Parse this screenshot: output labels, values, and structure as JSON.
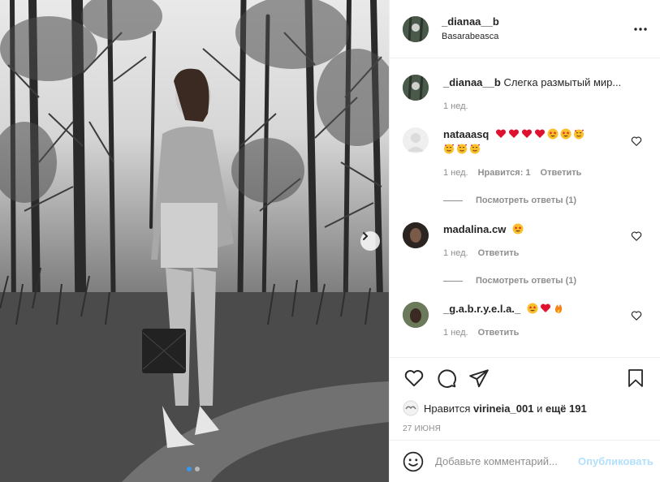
{
  "post": {
    "username": "_dianaa__b",
    "location": "Basarabeasca"
  },
  "caption": {
    "username": "_dianaa__b",
    "text": "Слегка размытый мир...",
    "time": "1 нед."
  },
  "comments": [
    {
      "username": "nataaasq",
      "emoji_line1": [
        "red-heart",
        "red-heart",
        "red-heart",
        "red-heart",
        "star-eyes",
        "star-eyes",
        "smiling-hearts"
      ],
      "emoji_line2": [
        "smiling-hearts",
        "smiling-hearts",
        "smiling-hearts"
      ],
      "time": "1 нед.",
      "likes_label": "Нравится: 1",
      "reply_label": "Ответить",
      "view_replies": "Посмотреть ответы (1)"
    },
    {
      "username": "madalina.cw",
      "emoji_line1": [
        "star-eyes"
      ],
      "time": "1 нед.",
      "reply_label": "Ответить",
      "view_replies": "Посмотреть ответы (1)"
    },
    {
      "username": "_g.a.b.r.y.e.l.a._",
      "emoji_line1": [
        "star-eyes",
        "red-heart",
        "fire"
      ],
      "time": "1 нед.",
      "reply_label": "Ответить"
    }
  ],
  "likes": {
    "prefix": "Нравится",
    "user": "virineia_001",
    "joiner": "и",
    "others": "ещё 191"
  },
  "date": "27 ИЮНЯ",
  "composer": {
    "placeholder": "Добавьте комментарий...",
    "publish_label": "Опубликовать"
  },
  "carousel": {
    "slide_count": 2,
    "active_index": 0
  },
  "colors": {
    "accent": "#3897f0",
    "publish_disabled": "#b2dffc",
    "heart_red": "#ed4956",
    "muted_text": "#8e8e8e"
  }
}
